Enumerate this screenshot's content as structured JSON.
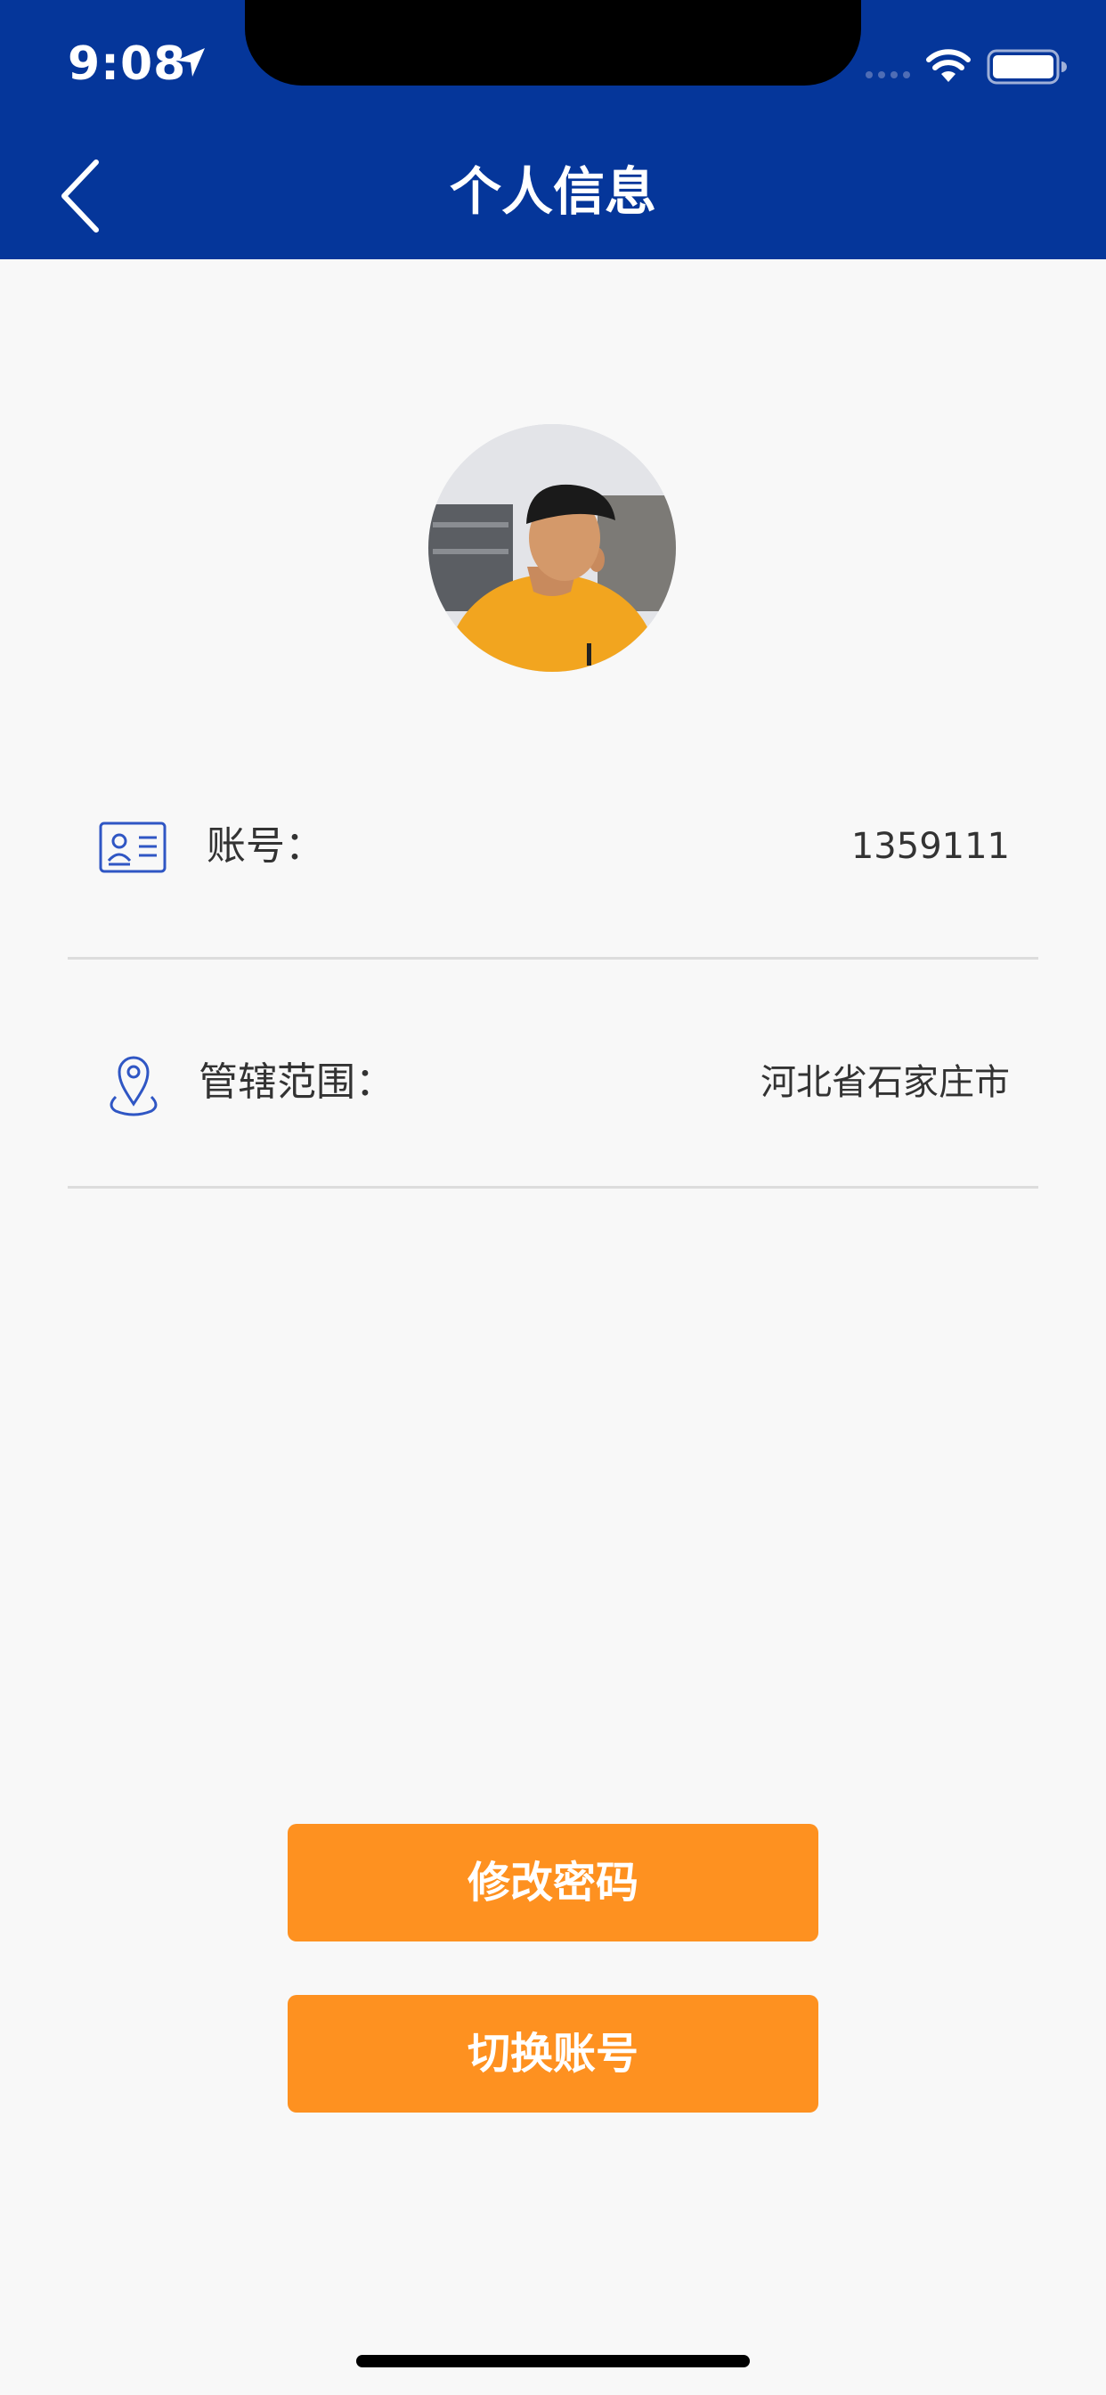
{
  "status_bar": {
    "time": "9:08"
  },
  "nav": {
    "title": "个人信息"
  },
  "profile": {
    "account_label": "账号：",
    "account_value": "1359111",
    "area_label": "管辖范围：",
    "area_value": "河北省石家庄市"
  },
  "actions": {
    "change_password": "修改密码",
    "switch_account": "切换账号"
  },
  "colors": {
    "header_bg": "#05369a",
    "button_bg": "#fe9120",
    "icon_blue": "#2f56c4"
  },
  "icons": [
    "location-arrow-icon",
    "wifi-icon",
    "battery-icon",
    "back-chevron-icon",
    "id-card-icon",
    "location-pin-icon"
  ]
}
